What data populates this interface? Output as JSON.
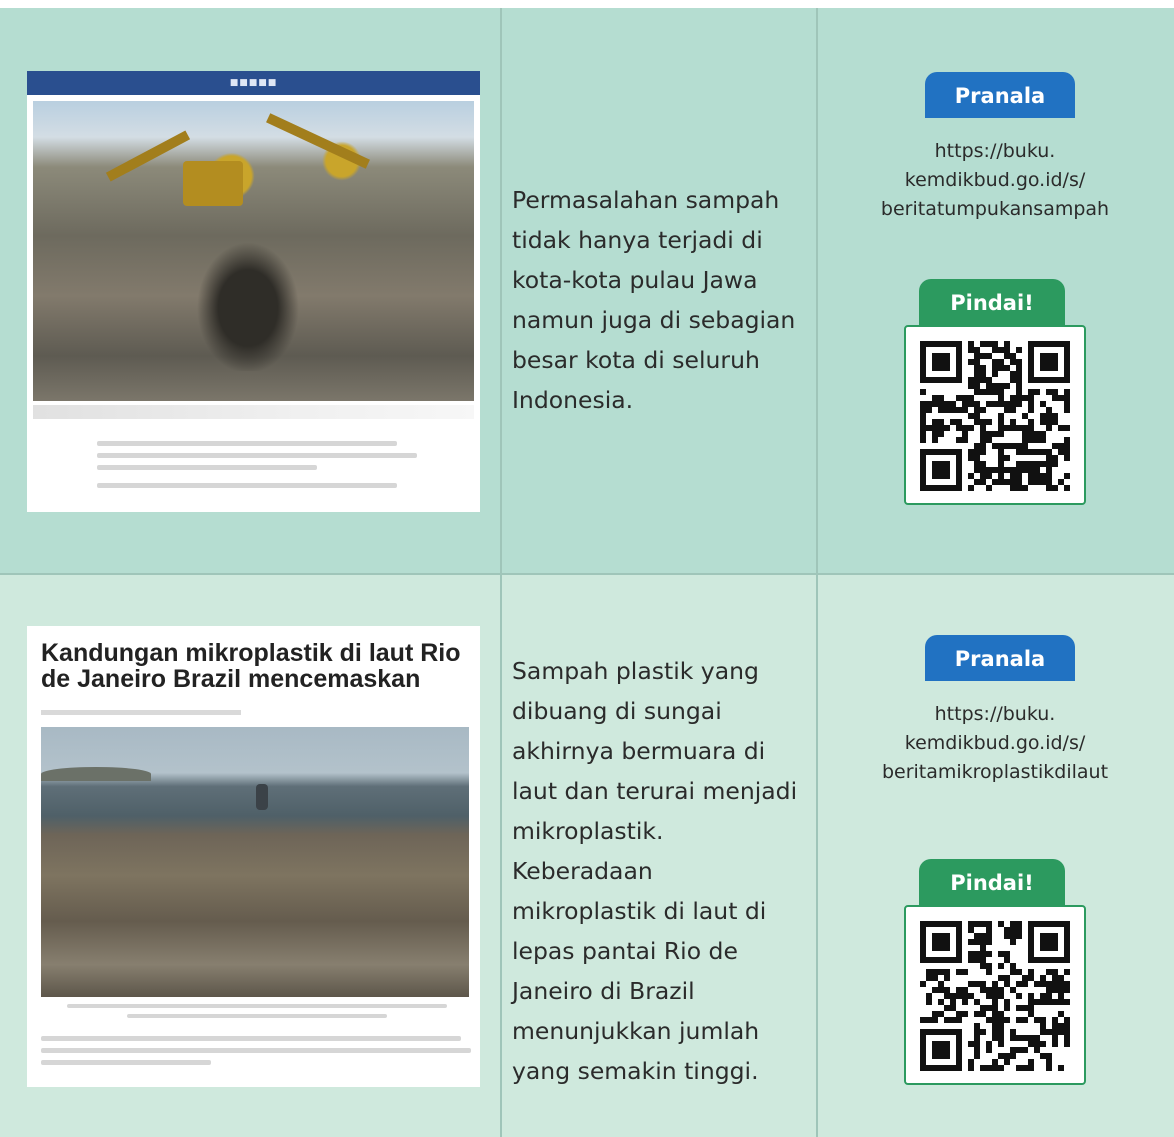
{
  "rows": [
    {
      "article_title": "",
      "description": "Permasalahan sampah tidak hanya terjadi di kota-kota pulau Jawa namun juga di sebagian besar kota di seluruh Indonesia.",
      "pranala_label": "Pranala",
      "url": "https://buku.kemdikbud.go.id/s/beritatumpukansampah",
      "pindai_label": "Pindai!",
      "qr_icon": "qr-code-icon"
    },
    {
      "article_title": "Kandungan mikroplastik di laut Rio de Janeiro Brazil mencemaskan",
      "description": "Sampah plastik yang dibuang di sungai akhirnya bermuara di laut dan terurai menjadi mikroplastik. Keberadaan mikroplastik di laut di lepas pantai Rio de Janeiro di Brazil menunjukkan jumlah yang semakin tinggi.",
      "pranala_label": "Pranala",
      "url": "https://buku.kemdikbud.go.id/s/beritamikroplastikdilaut",
      "pindai_label": "Pindai!",
      "qr_icon": "qr-code-icon"
    }
  ],
  "colors": {
    "row1_bg": "#b5ddd1",
    "row2_bg": "#cfe9dd",
    "pranala": "#2172c2",
    "pindai": "#2c9a5f"
  }
}
